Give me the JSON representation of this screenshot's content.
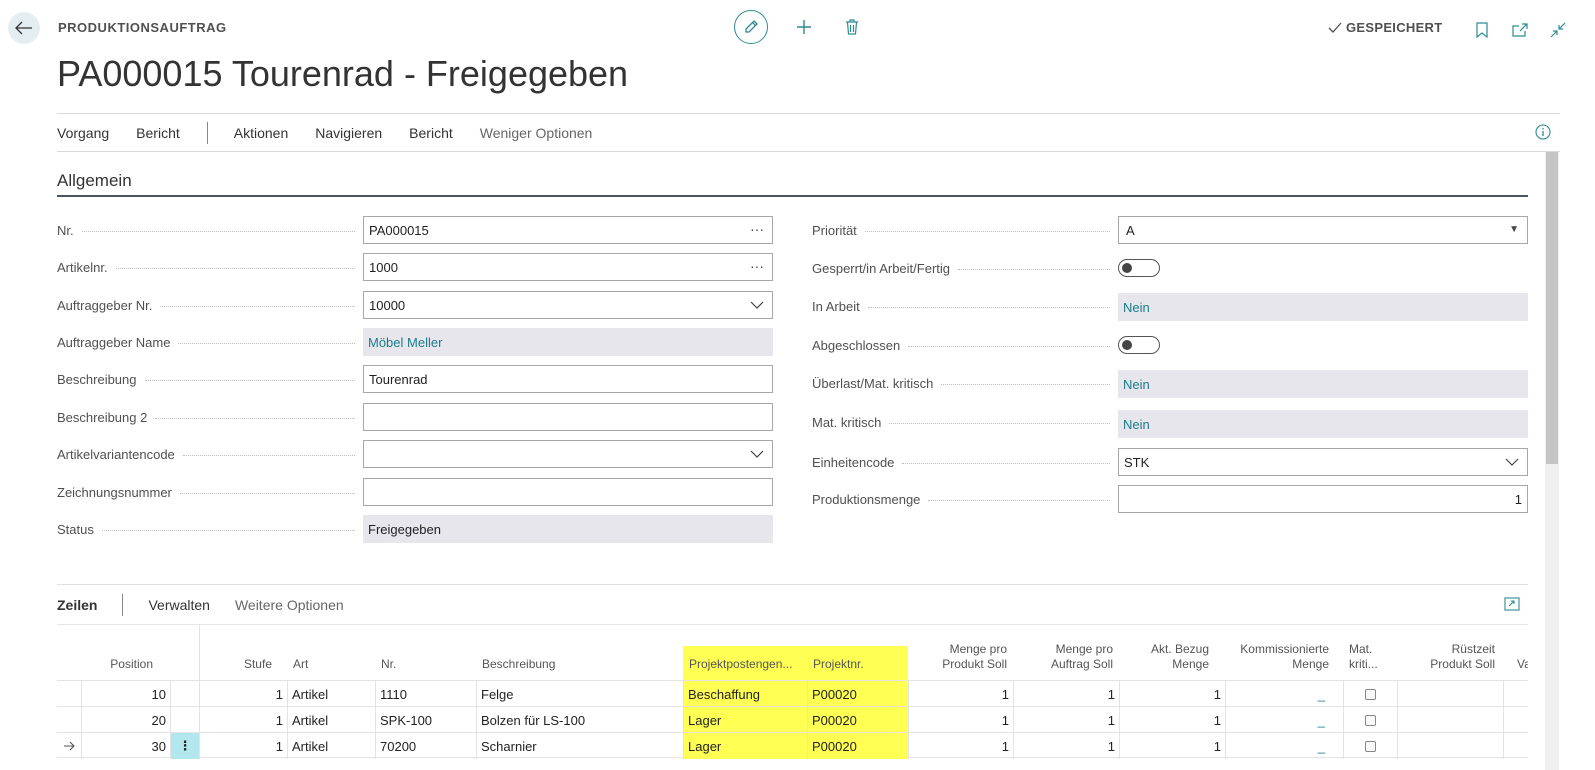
{
  "header": {
    "breadcrumb": "PRODUKTIONSAUFTRAG",
    "title": "PA000015 Tourenrad - Freigegeben",
    "saved_label": "GESPEICHERT"
  },
  "action_bar": {
    "items": [
      "Vorgang",
      "Bericht",
      "Aktionen",
      "Navigieren",
      "Bericht",
      "Weniger Optionen"
    ]
  },
  "section": {
    "title": "Allgemein"
  },
  "left_fields": [
    {
      "label": "Nr.",
      "value": "PA000015"
    },
    {
      "label": "Artikelnr.",
      "value": "1000"
    },
    {
      "label": "Auftraggeber Nr.",
      "value": "10000"
    },
    {
      "label": "Auftraggeber Name",
      "value": "Möbel Meller"
    },
    {
      "label": "Beschreibung",
      "value": "Tourenrad"
    },
    {
      "label": "Beschreibung 2",
      "value": ""
    },
    {
      "label": "Artikelvariantencode",
      "value": ""
    },
    {
      "label": "Zeichnungsnummer",
      "value": ""
    },
    {
      "label": "Status",
      "value": "Freigegeben"
    }
  ],
  "right_fields": [
    {
      "label": "Priorität",
      "value": "A"
    },
    {
      "label": "Gesperrt/in Arbeit/Fertig",
      "value": ""
    },
    {
      "label": "In Arbeit",
      "value": "Nein"
    },
    {
      "label": "Abgeschlossen",
      "value": ""
    },
    {
      "label": "Überlast/Mat. kritisch",
      "value": "Nein"
    },
    {
      "label": "Mat. kritisch",
      "value": "Nein"
    },
    {
      "label": "Einheitencode",
      "value": "STK"
    },
    {
      "label": "Produktionsmenge",
      "value": "1"
    }
  ],
  "lines": {
    "tabs": [
      "Zeilen",
      "Verwalten",
      "Weitere Optionen"
    ],
    "columns": {
      "position": "Position",
      "stufe": "Stufe",
      "art": "Art",
      "nr": "Nr.",
      "beschreibung": "Beschreibung",
      "projektposten": "Projektpostengen...",
      "projektnr": "Projektnr.",
      "menge_pro_produkt_1": "Menge pro",
      "menge_pro_produkt_2": "Produkt Soll",
      "menge_pro_auftrag_1": "Menge pro",
      "menge_pro_auftrag_2": "Auftrag Soll",
      "akt_bezug_1": "Akt. Bezug",
      "akt_bezug_2": "Menge",
      "kommissioniert_1": "Kommissionierte",
      "kommissioniert_2": "Menge",
      "mat_krit_1": "Mat.",
      "mat_krit_2": "kriti...",
      "ruestzeit_1": "Rüstzeit",
      "ruestzeit_2": "Produkt Soll",
      "va": "Va"
    },
    "rows": [
      {
        "position": "10",
        "stufe": "1",
        "art": "Artikel",
        "nr": "1110",
        "beschreibung": "Felge",
        "projektposten": "Beschaffung",
        "projektnr": "P00020",
        "menge_produkt": "1",
        "menge_auftrag": "1",
        "akt_bezug": "1",
        "kommissioniert": "_"
      },
      {
        "position": "20",
        "stufe": "1",
        "art": "Artikel",
        "nr": "SPK-100",
        "beschreibung": "Bolzen für LS-100",
        "projektposten": "Lager",
        "projektnr": "P00020",
        "menge_produkt": "1",
        "menge_auftrag": "1",
        "akt_bezug": "1",
        "kommissioniert": "_"
      },
      {
        "position": "30",
        "stufe": "1",
        "art": "Artikel",
        "nr": "70200",
        "beschreibung": "Scharnier",
        "projektposten": "Lager",
        "projektnr": "P00020",
        "menge_produkt": "1",
        "menge_auftrag": "1",
        "akt_bezug": "1",
        "kommissioniert": "_"
      }
    ]
  },
  "colors": {
    "accent": "#1b7d8a",
    "highlight": "#ffff54",
    "readonly_bg": "#e6e6ec"
  }
}
